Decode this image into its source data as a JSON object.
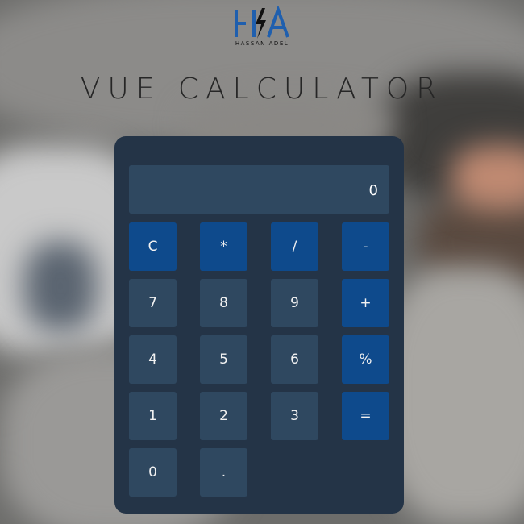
{
  "logo": {
    "initials": "HA",
    "subtitle": "HASSAN ADEL",
    "colors": {
      "primary": "#1f5fae"
    }
  },
  "title": "VUE CALCULATOR",
  "calculator": {
    "display_value": "0",
    "keys": [
      {
        "label": "C",
        "name": "clear",
        "type": "op"
      },
      {
        "label": "*",
        "name": "multiply",
        "type": "op"
      },
      {
        "label": "/",
        "name": "divide",
        "type": "op"
      },
      {
        "label": "-",
        "name": "subtract",
        "type": "op"
      },
      {
        "label": "7",
        "name": "7",
        "type": "num"
      },
      {
        "label": "8",
        "name": "8",
        "type": "num"
      },
      {
        "label": "9",
        "name": "9",
        "type": "num"
      },
      {
        "label": "+",
        "name": "add",
        "type": "op"
      },
      {
        "label": "4",
        "name": "4",
        "type": "num"
      },
      {
        "label": "5",
        "name": "5",
        "type": "num"
      },
      {
        "label": "6",
        "name": "6",
        "type": "num"
      },
      {
        "label": "%",
        "name": "percent",
        "type": "op"
      },
      {
        "label": "1",
        "name": "1",
        "type": "num"
      },
      {
        "label": "2",
        "name": "2",
        "type": "num"
      },
      {
        "label": "3",
        "name": "3",
        "type": "num"
      },
      {
        "label": "=",
        "name": "equals",
        "type": "op"
      },
      {
        "label": "0",
        "name": "0",
        "type": "num"
      },
      {
        "label": ".",
        "name": "decimal",
        "type": "num"
      }
    ]
  },
  "colors": {
    "panel": "#243447",
    "key": "#2f4860",
    "operator_key": "#0e4a8c"
  }
}
